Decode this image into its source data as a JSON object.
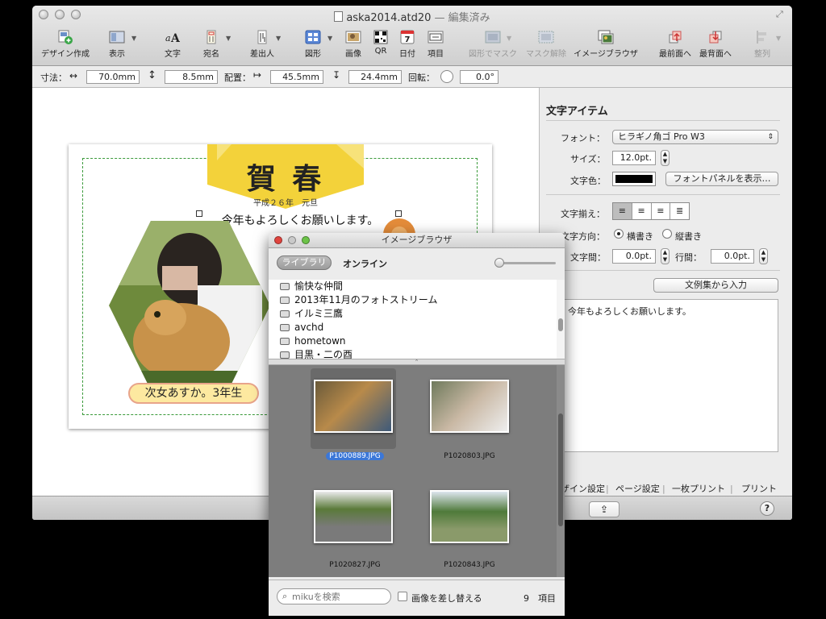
{
  "window": {
    "title": "aska2014.atd20",
    "title_suffix": "— 編集済み"
  },
  "toolbar": {
    "items": [
      {
        "label": "デザイン作成",
        "icon": "design-create-icon"
      },
      {
        "label": "表示",
        "icon": "view-icon"
      },
      {
        "label": "文字",
        "icon": "text-icon"
      },
      {
        "label": "宛名",
        "icon": "address-icon"
      },
      {
        "label": "差出人",
        "icon": "sender-icon"
      },
      {
        "label": "図形",
        "icon": "shape-icon"
      },
      {
        "label": "画像",
        "icon": "image-icon"
      },
      {
        "label": "QR",
        "icon": "qr-icon"
      },
      {
        "label": "日付",
        "icon": "date-icon"
      },
      {
        "label": "項目",
        "icon": "field-icon"
      },
      {
        "label": "図形でマスク",
        "icon": "shape-mask-icon"
      },
      {
        "label": "マスク解除",
        "icon": "unmask-icon"
      },
      {
        "label": "イメージブラウザ",
        "icon": "image-browser-icon"
      },
      {
        "label": "最前面へ",
        "icon": "bring-front-icon"
      },
      {
        "label": "最背面へ",
        "icon": "send-back-icon"
      },
      {
        "label": "整列",
        "icon": "align-icon"
      }
    ],
    "date_icon_text": "7"
  },
  "geometry_bar": {
    "size_label": "寸法：",
    "width_value": "70.0mm",
    "height_value": "8.5mm",
    "position_label": "配置：",
    "x_value": "45.5mm",
    "y_value": "24.4mm",
    "rotate_label": "回転：",
    "rotate_value": "0.0°"
  },
  "card": {
    "heading": "賀 春",
    "subheading": "平成２６年　元旦",
    "greeting": "今年もよろしくお願いします。",
    "caption": "次女あすか。3年生"
  },
  "text_panel": {
    "title": "文字アイテム",
    "font_label": "フォント：",
    "font_value": "ヒラギノ角ゴ Pro W3",
    "size_label": "サイズ：",
    "size_value": "12.0pt.",
    "color_label": "文字色：",
    "color_value": "#000000",
    "font_panel_button": "フォントパネルを表示…",
    "align_label": "文字揃え：",
    "direction_label": "文字方向：",
    "horizontal_label": "横書き",
    "vertical_label": "縦書き",
    "char_spacing_label": "文字間：",
    "char_spacing_value": "0.0pt.",
    "line_spacing_label": "行間：",
    "line_spacing_value": "0.0pt.",
    "insert_sample_button": "文例集から入力",
    "text_content": "今年もよろしくお願いします。"
  },
  "bottom_tabs": {
    "design": "ザイン設定",
    "page": "ページ設定",
    "single_print": "一枚プリント",
    "print": "プリント"
  },
  "image_browser": {
    "title": "イメージブラウザ",
    "tab_library": "ライブラリ",
    "tab_online": "オンライン",
    "sources": [
      "愉快な仲間",
      "2013年11月のフォトストリーム",
      "イルミ三鷹",
      "avchd",
      "hometown",
      "目黒・二の酉"
    ],
    "photos": [
      "P1000889.JPG",
      "P1020803.JPG",
      "P1020827.JPG",
      "P1020843.JPG"
    ],
    "search_placeholder": "mikuを検索",
    "replace_label": "画像を差し替える",
    "count_text": "9　項目"
  },
  "colors": {
    "accent_blue": "#3b77d8",
    "card_yellow": "#f3d23a",
    "caption_bg": "#fde9a0",
    "caption_border": "#e8a48a"
  }
}
